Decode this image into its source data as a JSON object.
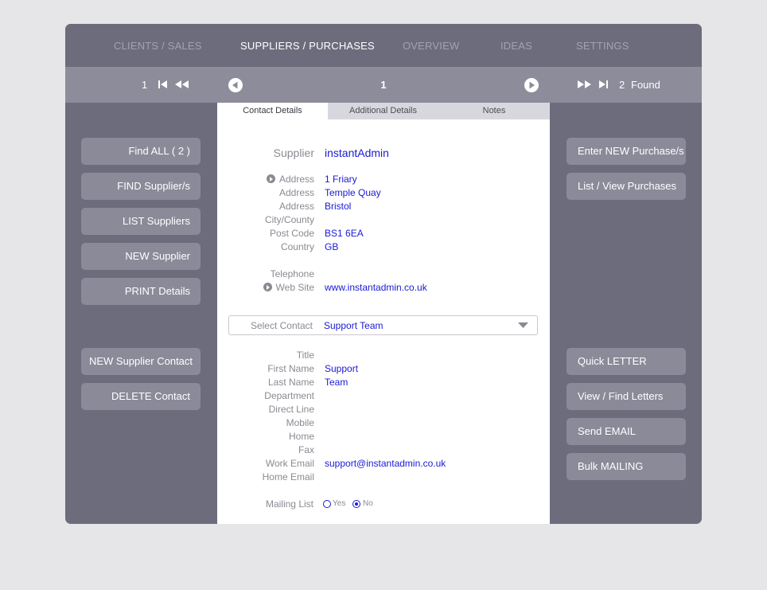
{
  "topnav": {
    "tabs": [
      {
        "label": "CLIENTS / SALES"
      },
      {
        "label": "SUPPLIERS / PURCHASES"
      },
      {
        "label": "OVERVIEW"
      },
      {
        "label": "IDEAS"
      },
      {
        "label": "SETTINGS"
      }
    ],
    "active_tab": "SUPPLIERS / PURCHASES"
  },
  "record_nav": {
    "current_record": "1",
    "center_record": "1",
    "found_count": "2",
    "found_label": "Found",
    "icons": [
      "first-record-icon",
      "previous-record-icon",
      "prev-circle-icon",
      "next-circle-icon",
      "next-record-icon",
      "last-record-icon"
    ]
  },
  "left_buttons": [
    {
      "label": "Find ALL  ( 2 )"
    },
    {
      "label": "FIND Supplier/s"
    },
    {
      "label": "LIST Suppliers"
    },
    {
      "label": "NEW Supplier"
    },
    {
      "label": "PRINT Details"
    }
  ],
  "left_buttons_lower": [
    {
      "label": "NEW Supplier Contact"
    },
    {
      "label": "DELETE Contact"
    }
  ],
  "right_buttons": [
    {
      "label": "Enter NEW Purchase/s"
    },
    {
      "label": "List / View Purchases"
    }
  ],
  "right_buttons_lower": [
    {
      "label": "Quick LETTER"
    },
    {
      "label": "View / Find Letters"
    },
    {
      "label": "Send EMAIL"
    },
    {
      "label": "Bulk MAILING"
    }
  ],
  "panel_tabs": [
    {
      "label": "Contact Details"
    },
    {
      "label": "Additional Details"
    },
    {
      "label": "Notes"
    }
  ],
  "supplier": {
    "label": "Supplier",
    "value": "instantAdmin"
  },
  "address": {
    "address1_label": "Address",
    "address1": "1 Friary",
    "address2_label": "Address",
    "address2": "Temple Quay",
    "address3_label": "Address",
    "address3": "Bristol",
    "city_label": "City/County",
    "city": "",
    "postcode_label": "Post Code",
    "postcode": "BS1 6EA",
    "country_label": "Country",
    "country": "GB",
    "telephone_label": "Telephone",
    "telephone": "",
    "website_label": "Web Site",
    "website": "www.instantadmin.co.uk"
  },
  "select_contact": {
    "label": "Select Contact",
    "value": "Support Team"
  },
  "contact": {
    "title_label": "Title",
    "title": "",
    "first_name_label": "First Name",
    "first_name": "Support",
    "last_name_label": "Last Name",
    "last_name": "Team",
    "department_label": "Department",
    "department": "",
    "direct_line_label": "Direct Line",
    "direct_line": "",
    "mobile_label": "Mobile",
    "mobile": "",
    "home_label": "Home",
    "home": "",
    "fax_label": "Fax",
    "fax": "",
    "work_email_label": "Work Email",
    "work_email": "support@instantadmin.co.uk",
    "home_email_label": "Home Email",
    "home_email": ""
  },
  "mailing_list": {
    "label": "Mailing List",
    "yes_label": "Yes",
    "no_label": "No",
    "selected": "No"
  },
  "colors": {
    "app_bg": "#6d6c7c",
    "strip_bg": "#8d8c9b",
    "button_bg": "#8b8a99",
    "value_text": "#1a1ad6",
    "label_text": "#8a8a92"
  }
}
